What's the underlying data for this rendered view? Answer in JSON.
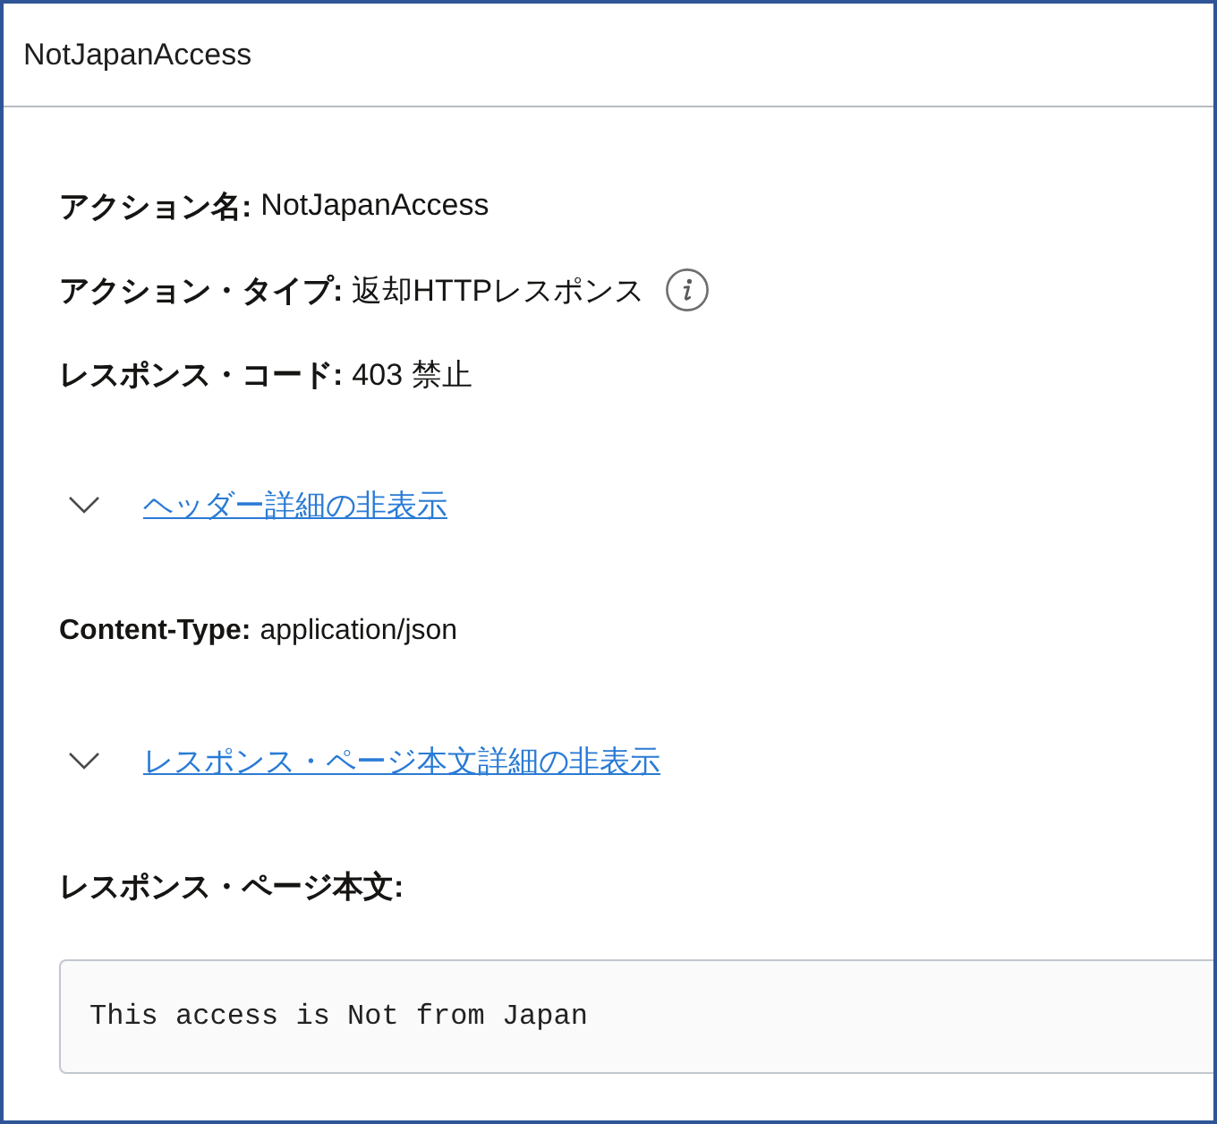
{
  "panel": {
    "title": "NotJapanAccess"
  },
  "fields": [
    {
      "label": "アクション名:",
      "value": "NotJapanAccess",
      "info_icon": false
    },
    {
      "label": "アクション・タイプ:",
      "value": "返却HTTPレスポンス",
      "info_icon": true
    },
    {
      "label": "レスポンス・コード:",
      "value": "403 禁止",
      "info_icon": false
    }
  ],
  "header_toggle": {
    "label": "ヘッダー詳細の非表示",
    "expanded": true
  },
  "headers": [
    {
      "label": "Content-Type:",
      "value": "application/json"
    }
  ],
  "body_toggle": {
    "label": "レスポンス・ページ本文詳細の非表示",
    "expanded": true
  },
  "body": {
    "label": "レスポンス・ページ本文:",
    "value": "This access is Not from Japan"
  }
}
